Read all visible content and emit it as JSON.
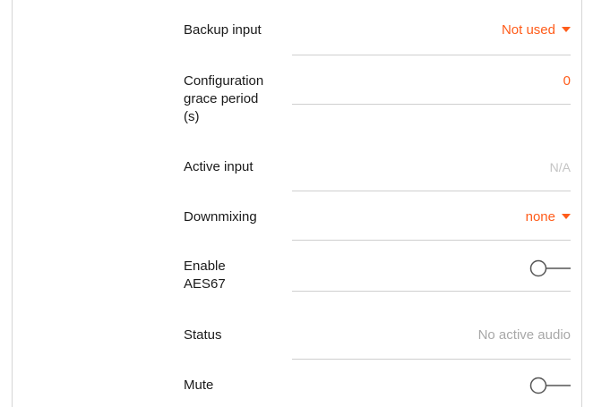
{
  "settings": {
    "backup_input": {
      "label": "Backup input",
      "value": "Not used"
    },
    "grace_period": {
      "label": "Configuration\ngrace period\n(s)",
      "value": "0"
    },
    "active_input": {
      "label": "Active input",
      "value": "N/A"
    },
    "downmixing": {
      "label": "Downmixing",
      "value": "none"
    },
    "enable_aes67": {
      "label": "Enable\nAES67",
      "enabled": false
    },
    "status": {
      "label": "Status",
      "value": "No active audio"
    },
    "mute": {
      "label": "Mute",
      "enabled": false
    }
  },
  "colors": {
    "accent": "#ff5c1a",
    "label_text": "#1a1a1a",
    "muted_text": "#a8a8a8",
    "divider": "#cfcfcf"
  },
  "icons": {
    "dropdown": "caret-down-icon",
    "toggle": "toggle-off-icon"
  }
}
